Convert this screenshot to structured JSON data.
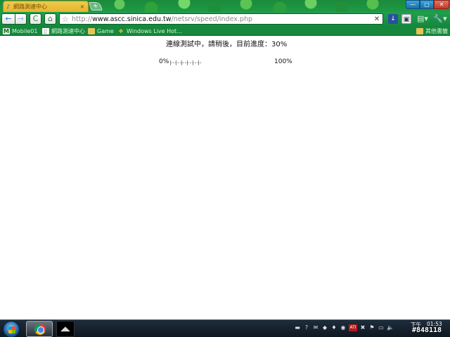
{
  "window": {
    "tab_title": "網路測速中心",
    "new_tab_label": "+",
    "controls": {
      "minimize": "—",
      "maximize": "▢",
      "close": "✕"
    }
  },
  "toolbar": {
    "back_icon": "←",
    "forward_icon": "→",
    "reload_icon": "C",
    "home_icon": "⌂",
    "url_prefix": "http://",
    "url_host": "www.ascc.sinica.edu.tw",
    "url_path": "/netsrv/speed/index.php",
    "star_icon": "☆",
    "clear_icon": "✕"
  },
  "bookmarks": {
    "items": [
      {
        "label": "Mobile01",
        "icon": "mobile01-icon"
      },
      {
        "label": "網路測速中心",
        "icon": "page-icon"
      },
      {
        "label": "Game",
        "icon": "folder-icon"
      },
      {
        "label": "Windows Live Hot...",
        "icon": "windows-icon"
      }
    ],
    "other_bookmarks": "其他書籤"
  },
  "page": {
    "status_text": "連線測試中，請稍後，目前進度：30%",
    "start_label": "0%",
    "end_label": "100%",
    "progress_fraction": 0.3
  },
  "taskbar": {
    "clock_date": "下午",
    "clock_time": "01:53",
    "watermark": "#848118"
  },
  "colors": {
    "browser_green": "#16883d",
    "tab_gold": "#e7b52f",
    "progress_tick": "#6a6a6a"
  }
}
